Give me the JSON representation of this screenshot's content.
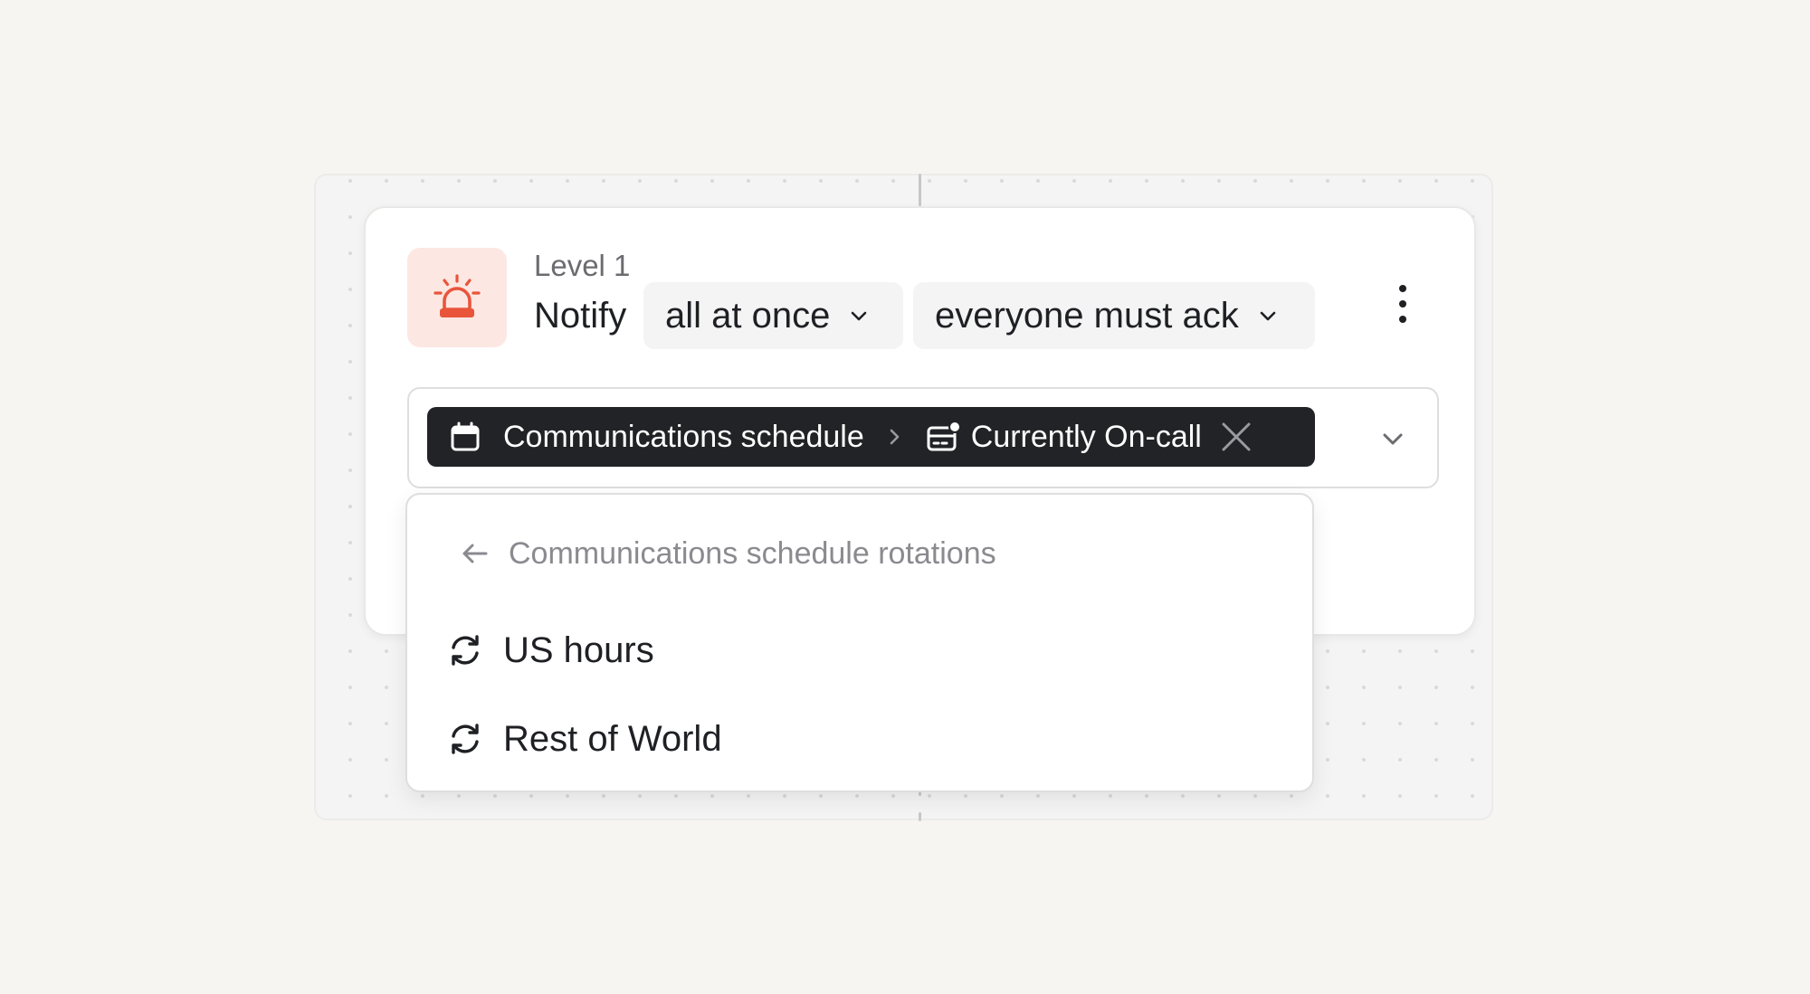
{
  "level": {
    "label": "Level 1",
    "icon": "siren-icon",
    "icon_color": "#e8553b",
    "icon_bg": "#fde7e2"
  },
  "notify": {
    "label": "Notify",
    "mode": "all at once",
    "ack_rule": "everyone must ack"
  },
  "menu": {
    "icon": "more-vertical-icon"
  },
  "target": {
    "schedule_icon": "calendar-icon",
    "schedule_name": "Communications schedule",
    "separator_icon": "chevron-right-icon",
    "oncall_icon": "on-call-icon",
    "oncall_label": "Currently On-call",
    "remove_icon": "close-icon",
    "chip_bg": "#222326"
  },
  "dropdown": {
    "back_icon": "arrow-left-icon",
    "header": "Communications schedule rotations",
    "items": [
      {
        "label": "US hours",
        "icon": "rotation-icon"
      },
      {
        "label": "Rest of World",
        "icon": "rotation-icon"
      }
    ]
  }
}
